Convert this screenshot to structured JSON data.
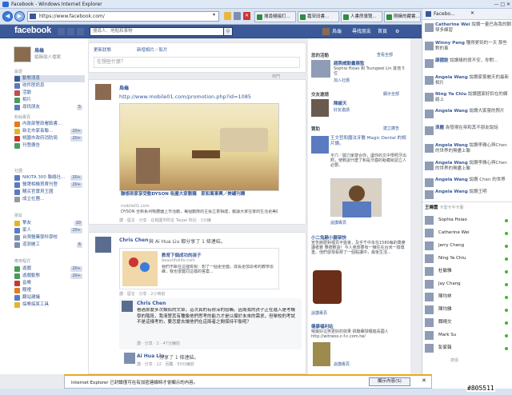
{
  "browser": {
    "title": "Facebook - Windows Internet Explorer",
    "url": "https://www.facebook.com/",
    "tabs": [
      "Faceb...",
      "搜尋鏈接訂...",
      "嘉宋旧書...",
      "人書房導覽...",
      "剛擁的藏書..."
    ],
    "active_tab": "Faceb..."
  },
  "fb": {
    "logo": "facebook",
    "search_placeholder": "搜尋人、地點和事物",
    "topnav": {
      "user": "烏龜",
      "find_friends": "尋找朋友",
      "home": "首頁"
    }
  },
  "left": {
    "name": "烏龜",
    "edit_profile": "編輯個人檔案",
    "favorites_h": "最愛",
    "favorites": [
      {
        "label": "動態消息",
        "count": ""
      },
      {
        "label": "收件匣訊息",
        "count": ""
      },
      {
        "label": "活動",
        "count": ""
      },
      {
        "label": "相片",
        "count": ""
      },
      {
        "label": "尋找朋友",
        "count": "5"
      }
    ],
    "pages_h": "粉絲專頁",
    "pages": [
      {
        "label": "內政部警政署臉書...",
        "count": ""
      },
      {
        "label": "新北市家長聯...",
        "count": "20+"
      },
      {
        "label": "桃園市政府消防局",
        "count": "20+"
      },
      {
        "label": "刊登廣告",
        "count": ""
      }
    ],
    "groups_h": "社團",
    "groups": [
      {
        "label": "NIKITA 300 聯絡社...",
        "count": "20+"
      },
      {
        "label": "醫牌相機買賣刊登",
        "count": "20+"
      },
      {
        "label": "購买官寶貝王國",
        "count": ""
      },
      {
        "label": "成立社團...",
        "count": ""
      }
    ],
    "friends_h": "朋友",
    "friends": [
      {
        "label": "摯友",
        "count": "10"
      },
      {
        "label": "家人",
        "count": "20+"
      },
      {
        "label": "台灣醫藥學科學校",
        "count": ""
      },
      {
        "label": "道澍麗工",
        "count": "6"
      }
    ],
    "apps_h": "應用程式",
    "apps": [
      {
        "label": "遊戲",
        "count": "20+"
      },
      {
        "label": "遊戲動態",
        "count": "20+"
      },
      {
        "label": "音樂",
        "count": ""
      },
      {
        "label": "贈禮",
        "count": ""
      },
      {
        "label": "翻站建議",
        "count": ""
      },
      {
        "label": "搞樂搞笑工具",
        "count": ""
      }
    ]
  },
  "composer": {
    "update_status": "更新狀態",
    "add_photo": "新增相片／影片",
    "placeholder": "在想些什麼？",
    "sort": "熱門"
  },
  "posts": [
    {
      "author": "烏龜",
      "link_url": "http://www.mobile01.com/promotion.php?id=1085",
      "link_title": "聯想到家享受動DYSON 吸塵大家刪購　家和萬事興／美罐刊轉",
      "link_domain": "mobile01.com",
      "link_desc": "DYSON 全新系列吸塵器上市活動，每個動態的主張立意相建，都讓大家在家的生活更美好...",
      "actions": "讚 · 留言 · 分享 · 在桃園市附近 Taipei 附近 · 1分鐘"
    },
    {
      "author": "Chris Chen",
      "action": "與 Ai Hua Liu 都分享了 1 條連結。",
      "link_title": "教育下個成功的孩子",
      "link_domain": "beautifullife.com",
      "link_desc": "我們不斷在這裡檢視：想了一個更全面，成長更加思考的教學思維，我也很贊同這樣的答案...",
      "actions": "讚 · 留言 · 分享 · 2小時前",
      "comment_author": "Chris Chen",
      "comment_text": "看過那麼多次類似的文章，這次真的有很深的感觸。因為我的孩子正在進入是考機學的階段，我清楚其有種像他們思考的能力才是以爆於未來的需求，但舉校的考試不是這樣考的，要怎麼去讓他們在這兩者之間保持平衡呢？",
      "comment_meta": "讚 · 分享 · 2 · 47分鐘前",
      "share2_author": "Ai Hua Liu",
      "share2_action": "分享了 1 條連結。",
      "share2_meta": "讚 · 分享 · 12 · 回覆 · 50分鐘前"
    }
  ],
  "right": {
    "events_h": "您的活動",
    "events_link": "查看全部",
    "event_name": "趙照威動畫展監",
    "event_people": "Sophia Hsiao 和 Tsungwei Lin 其他 5 位",
    "event_join": "加入社團",
    "suggest_h": "交友邀請",
    "suggest_link": "顯示全部",
    "suggest_name": "陳綾天",
    "suggest_add": "好友邀請",
    "ads_h": "贊助",
    "ads_link": "建立廣告",
    "ad1_title": "王文哲和魔法牙醫 Magic Dental 的相片讚。",
    "ad1_desc": "平穴／開刀家建合你，讓你的文中學照牙出照，使數說什麼了和是牙齒的蛤蟆就認立人必要。",
    "ad1_cta": "說讚專頁",
    "ad2_h": "小二兔騎小腳架快",
    "ad2_desc": "宣告將歷對裡頁平盤會，及乎千中永在1580每的喬麥讀者雅 華德數語！今人我想要有一棟住在台米一樣尊重。他們發現看那了一個點讀中，最後生活...",
    "ad2_cta": "說讚專頁",
    "ad3_h": "健康福利站",
    "ad3_desc": "嗯最好這男更好的效果 搞聯賽球種進長國人 http://witness.c-f-c.com.tw/",
    "ad3_cta": "說讚專頁"
  },
  "chat": {
    "tab_label": "Facebo...",
    "ticker": [
      {
        "name": "Catherine Wei",
        "text": "說讚一量巴為我的鋼琴多練習"
      },
      {
        "name": "Winny Peng",
        "text": "種得更到的一天 那些對的事"
      },
      {
        "name": "康國銓",
        "text": "說讚樣的很不安，你對..."
      },
      {
        "name": "Angela Wang",
        "text": "說讚家靈麗天的最新相片"
      },
      {
        "name": "Ning Ya Chiu",
        "text": "說讚國家好鈴在的網絡上"
      },
      {
        "name": "Angela Wang",
        "text": "說讚大家靈的照片"
      },
      {
        "name": "浪麗",
        "text": "為發現在帝和其不朋友說話"
      },
      {
        "name": "Angela Wang",
        "text": "說讚李雅心與Chen的世界的無盡上聯"
      },
      {
        "name": "Angela Wang",
        "text": "說讚李雅心與Chen的世界的無盡上聯"
      },
      {
        "name": "Angela Wang",
        "text": "說讚 Chen 的世界"
      },
      {
        "name": "Angela Wang",
        "text": "說讚王明"
      }
    ],
    "online_header": "王曉雲",
    "online_header_sub": "卡雷卡平卡蕾",
    "friends": [
      "Sophia Hsiao",
      "Catherine Wei",
      "Jerry Cheng",
      "Ning Ya Chiu",
      "杜敏雅",
      "Jay Chang",
      "陳均祥",
      "陳均雅",
      "顏晴文",
      "Mark Su",
      "彭家薇"
    ],
    "search": "搜尋"
  },
  "ie_notice": {
    "text": "Internet Explorer 已封鎖僅可在有加密連線時才會顯示的內容。",
    "button": "顯示內容(S)"
  },
  "watermark": "#805511",
  "colors": {
    "fb_blue": "#3b5998",
    "link": "#365899",
    "online": "#42b72a"
  }
}
